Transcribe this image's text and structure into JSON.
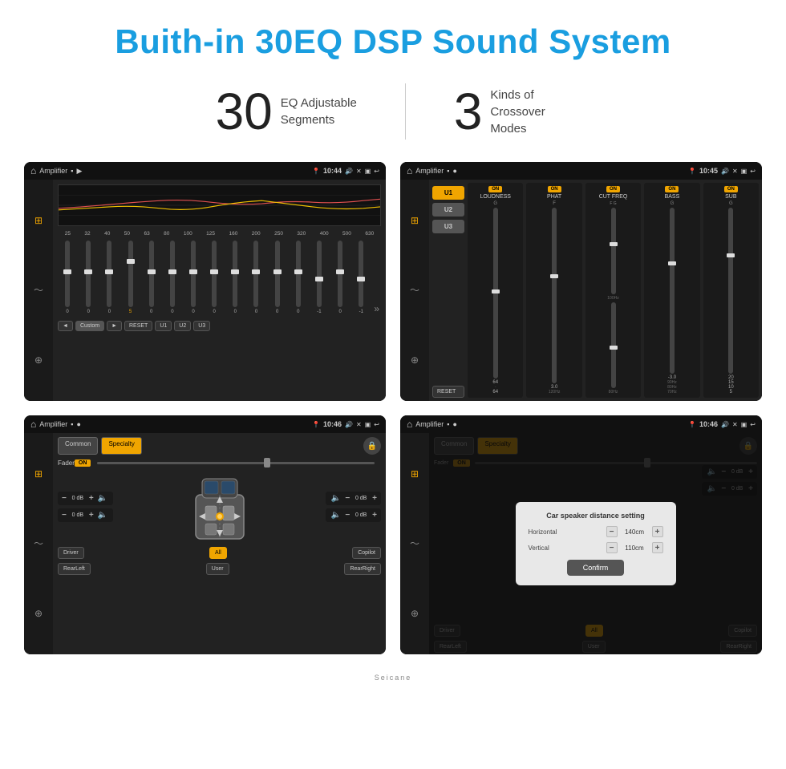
{
  "title": "Buith-in 30EQ DSP Sound System",
  "stats": [
    {
      "number": "30",
      "label": "EQ Adjustable\nSegments"
    },
    {
      "number": "3",
      "label": "Kinds of\nCrossover Modes"
    }
  ],
  "screens": [
    {
      "id": "eq-screen",
      "statusBar": {
        "app": "Amplifier",
        "time": "10:44"
      },
      "freqLabels": [
        "25",
        "32",
        "40",
        "50",
        "63",
        "80",
        "100",
        "125",
        "160",
        "200",
        "250",
        "320",
        "400",
        "500",
        "630"
      ],
      "sliderValues": [
        "0",
        "0",
        "0",
        "5",
        "0",
        "0",
        "0",
        "0",
        "0",
        "0",
        "0",
        "0",
        "-1",
        "0",
        "-1"
      ],
      "sliderPositions": [
        50,
        50,
        50,
        35,
        50,
        50,
        50,
        50,
        50,
        50,
        50,
        50,
        65,
        50,
        65
      ],
      "bottomButtons": [
        "◄",
        "Custom",
        "►",
        "RESET",
        "U1",
        "U2",
        "U3"
      ]
    },
    {
      "id": "crossover-screen",
      "statusBar": {
        "app": "Amplifier",
        "time": "10:45"
      },
      "uButtons": [
        "U1",
        "U2",
        "U3"
      ],
      "bands": [
        {
          "name": "LOUDNESS",
          "on": true
        },
        {
          "name": "PHAT",
          "on": true
        },
        {
          "name": "CUT FREQ",
          "on": true
        },
        {
          "name": "BASS",
          "on": true
        },
        {
          "name": "SUB",
          "on": true
        }
      ]
    },
    {
      "id": "fader-screen",
      "statusBar": {
        "app": "Amplifier",
        "time": "10:46"
      },
      "tabs": [
        "Common",
        "Specialty"
      ],
      "activeTab": "Specialty",
      "faderLabel": "Fader",
      "faderOn": true,
      "speakers": {
        "frontLeft": "0 dB",
        "frontRight": "0 dB",
        "rearLeft": "0 dB",
        "rearRight": "0 dB"
      },
      "bottomButtons": [
        "Driver",
        "All",
        "Copilot",
        "RearLeft",
        "User",
        "RearRight"
      ]
    },
    {
      "id": "dialog-screen",
      "statusBar": {
        "app": "Amplifier",
        "time": "10:46"
      },
      "tabs": [
        "Common",
        "Specialty"
      ],
      "activeTab": "Specialty",
      "dialog": {
        "title": "Car speaker distance setting",
        "horizontal": {
          "label": "Horizontal",
          "value": "140cm"
        },
        "vertical": {
          "label": "Vertical",
          "value": "110cm"
        },
        "confirmLabel": "Confirm"
      },
      "speakers": {
        "frontRight": "0 dB",
        "rearRight": "0 dB"
      },
      "bottomButtons": [
        "Driver",
        "All",
        "Copilot",
        "RearLeft",
        "User",
        "RearRight"
      ]
    }
  ],
  "watermark": "Seicane"
}
